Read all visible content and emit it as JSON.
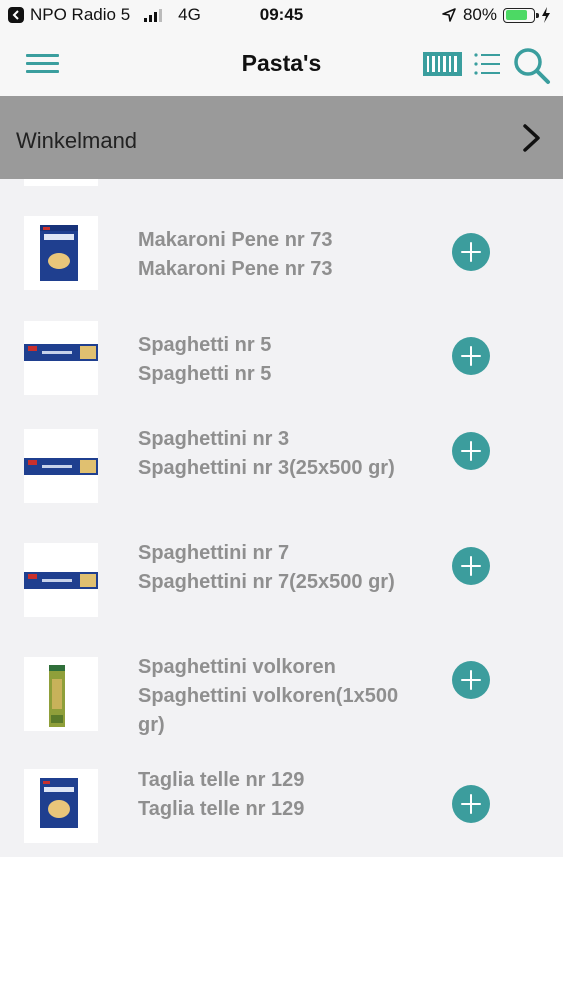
{
  "status_bar": {
    "carrier": "NPO Radio 5",
    "network": "4G",
    "time": "09:45",
    "battery_percent": "80%",
    "battery_level": 0.8
  },
  "nav": {
    "title": "Pasta's",
    "icons": [
      "menu-icon",
      "barcode-icon",
      "list-icon",
      "search-icon"
    ],
    "accent_color": "#3a9e9e"
  },
  "cart": {
    "label": "Winkelmand"
  },
  "products": [
    {
      "name": "Makaroni Pene nr 73",
      "description": "Makaroni Pene nr 73"
    },
    {
      "name": "Spaghetti nr 5",
      "description": "Spaghetti nr 5"
    },
    {
      "name": "Spaghettini nr 3",
      "description": "Spaghettini nr 3(25x500 gr)"
    },
    {
      "name": "Spaghettini nr 7",
      "description": "Spaghettini nr 7(25x500 gr)"
    },
    {
      "name": "Spaghettini volkoren",
      "description": "Spaghettini volkoren(1x500 gr)"
    },
    {
      "name": "Taglia telle nr 129",
      "description": "Taglia telle nr 129"
    }
  ]
}
